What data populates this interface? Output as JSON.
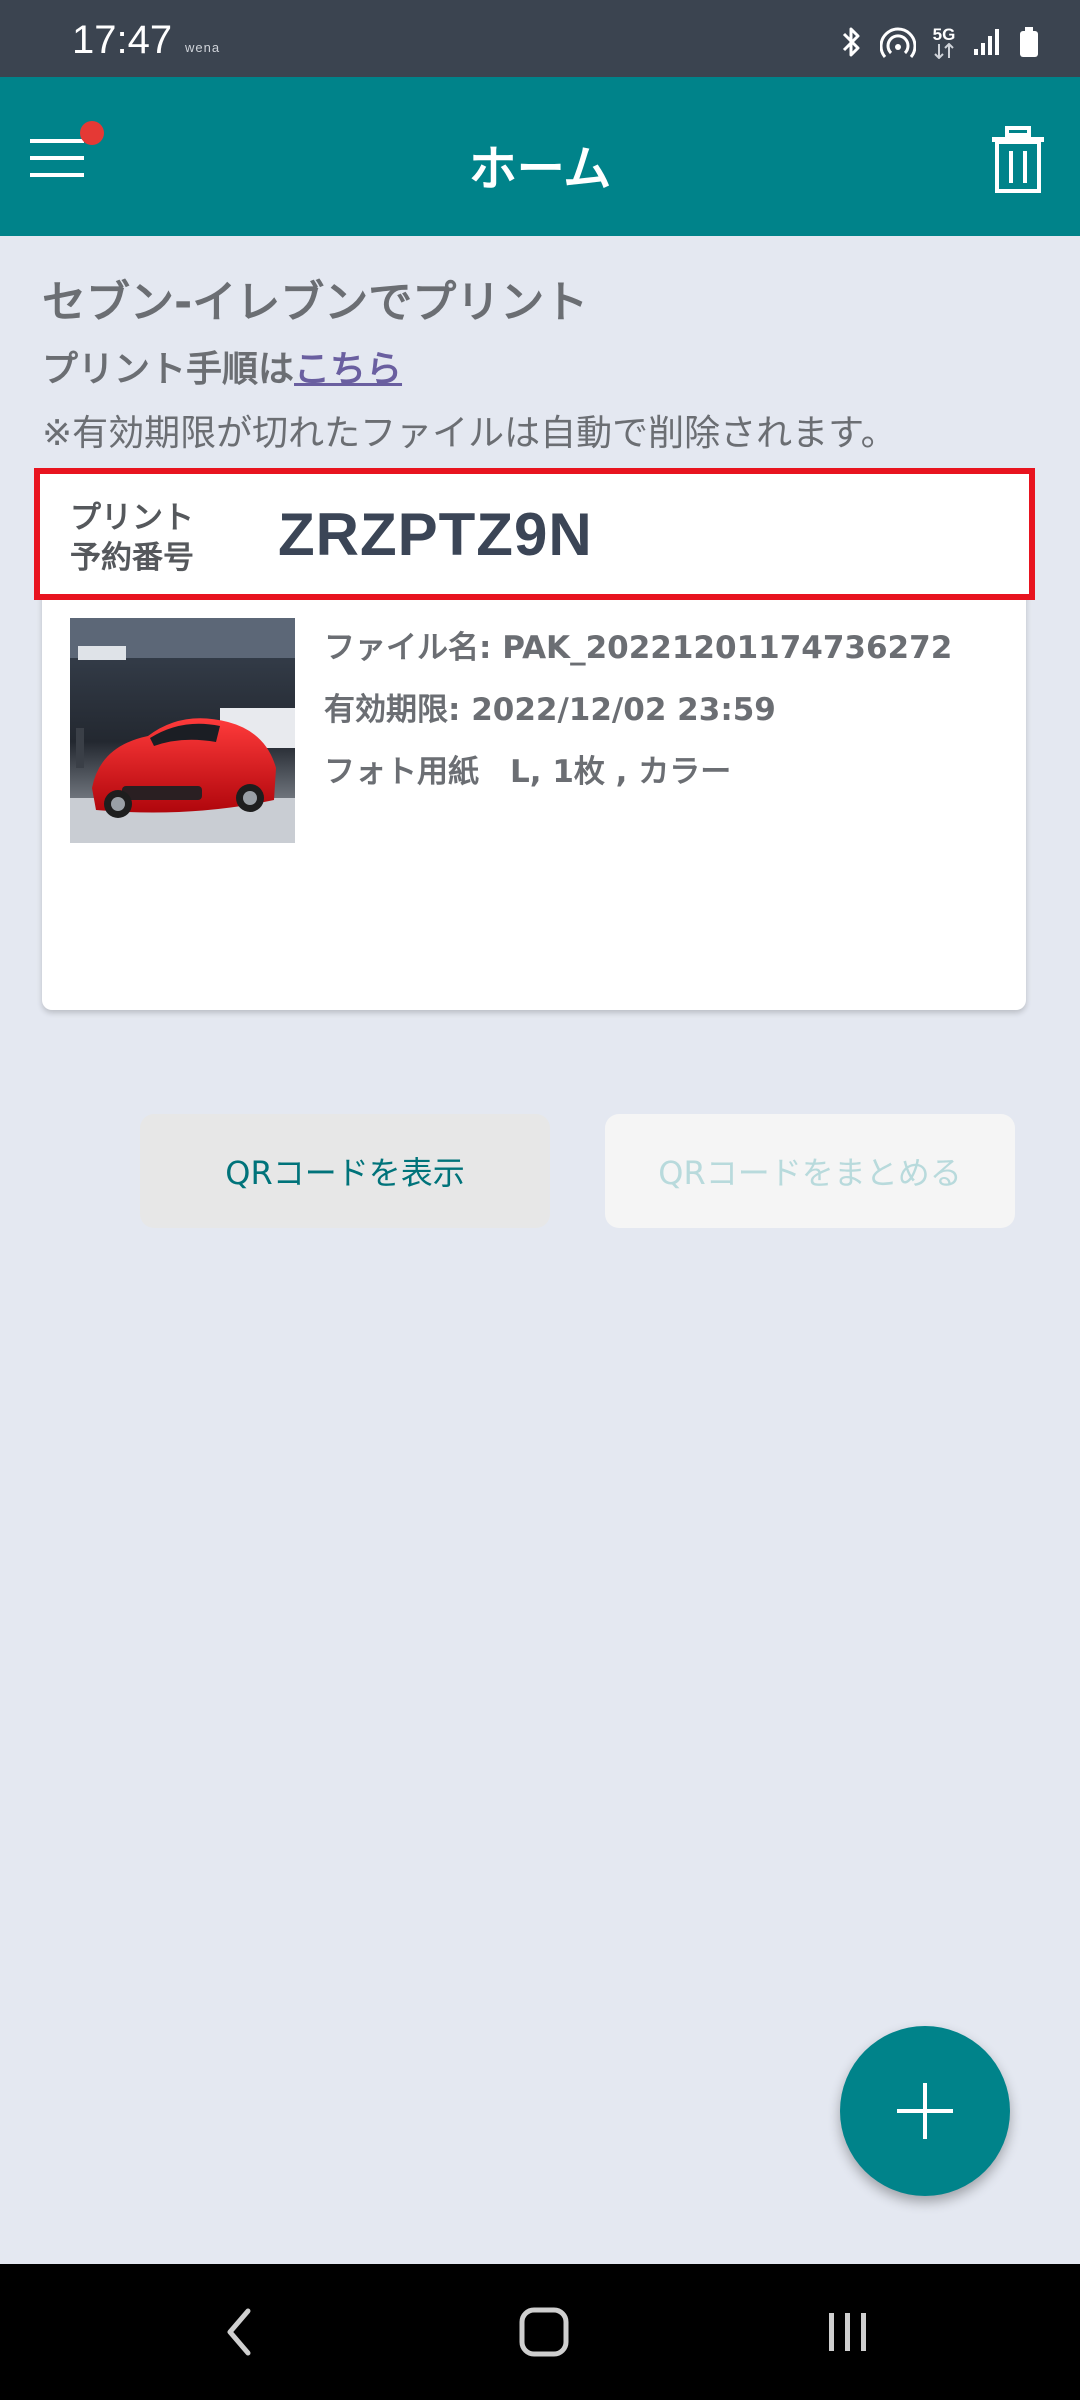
{
  "status_bar": {
    "time": "17:47",
    "carrier_tag": "wena",
    "network": "5G",
    "icons": [
      "bluetooth-icon",
      "hotspot-icon",
      "5g-icon",
      "signal-icon",
      "battery-icon"
    ]
  },
  "app_bar": {
    "title": "ホーム",
    "menu_icon": "hamburger-menu-icon",
    "notification_dot_color": "#e53935",
    "trash_icon": "trash-icon",
    "background": "#00838a"
  },
  "main": {
    "heading": "セブン-イレブンでプリント",
    "howto_prefix": "プリント手順は",
    "howto_link": "こちら",
    "notice": "※有効期限が切れたファイルは自動で削除されます。"
  },
  "card": {
    "reservation_label_line1": "プリント",
    "reservation_label_line2": "予約番号",
    "reservation_number": "ZRZPTZ9N",
    "file_name": "ファイル名: PAK_20221201174736272",
    "expiry": "有効期限: 2022/12/02 23:59",
    "paper": "フォト用紙　L,  1枚 ,  カラー",
    "show_qr_button": "QRコードを表示",
    "combine_qr_button": "QRコードをまとめる"
  },
  "fab": {
    "icon": "plus-icon"
  },
  "nav": {
    "back_icon": "back-icon",
    "home_icon": "home-icon",
    "recents_icon": "recents-icon"
  }
}
